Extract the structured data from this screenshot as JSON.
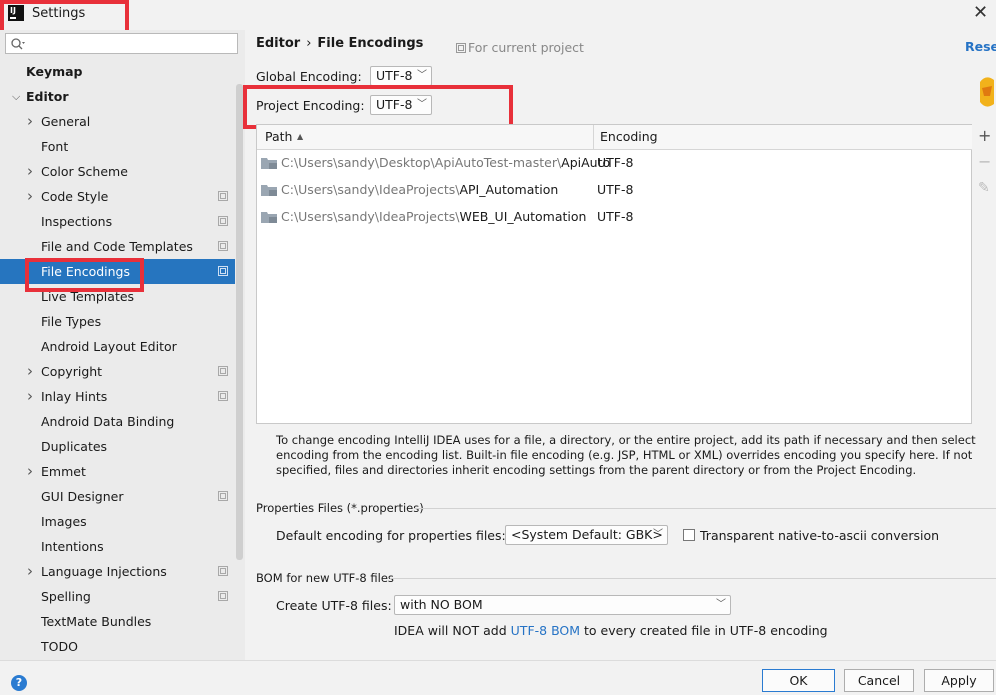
{
  "window": {
    "title": "Settings",
    "app_icon_text": "IJ"
  },
  "search": {
    "placeholder": ""
  },
  "sidebar": {
    "items": [
      {
        "label": "Keymap"
      },
      {
        "label": "Editor"
      },
      {
        "label": "General"
      },
      {
        "label": "Font"
      },
      {
        "label": "Color Scheme"
      },
      {
        "label": "Code Style"
      },
      {
        "label": "Inspections"
      },
      {
        "label": "File and Code Templates"
      },
      {
        "label": "File Encodings"
      },
      {
        "label": "Live Templates"
      },
      {
        "label": "File Types"
      },
      {
        "label": "Android Layout Editor"
      },
      {
        "label": "Copyright"
      },
      {
        "label": "Inlay Hints"
      },
      {
        "label": "Android Data Binding"
      },
      {
        "label": "Duplicates"
      },
      {
        "label": "Emmet"
      },
      {
        "label": "GUI Designer"
      },
      {
        "label": "Images"
      },
      {
        "label": "Intentions"
      },
      {
        "label": "Language Injections"
      },
      {
        "label": "Spelling"
      },
      {
        "label": "TextMate Bundles"
      },
      {
        "label": "TODO"
      }
    ]
  },
  "breadcrumb": {
    "parent": "Editor",
    "separator": "›",
    "current": "File Encodings"
  },
  "for_current_project": "For current project",
  "reset_label": "Reset",
  "global_encoding": {
    "label": "Global Encoding:",
    "value": "UTF-8"
  },
  "project_encoding": {
    "label": "Project Encoding:",
    "value": "UTF-8"
  },
  "table": {
    "headers": {
      "path": "Path",
      "sort": "▲",
      "encoding": "Encoding"
    },
    "rows": [
      {
        "path_prefix": "C:\\Users\\sandy\\Desktop\\ApiAutoTest-master\\",
        "path_name": "ApiAuto",
        "encoding": "UTF-8"
      },
      {
        "path_prefix": "C:\\Users\\sandy\\IdeaProjects\\",
        "path_name": "API_Automation",
        "encoding": "UTF-8"
      },
      {
        "path_prefix": "C:\\Users\\sandy\\IdeaProjects\\",
        "path_name": "WEB_UI_Automation",
        "encoding": "UTF-8"
      }
    ]
  },
  "table_tools": {
    "add": "+",
    "remove": "−",
    "edit": "✎"
  },
  "help_text": "To change encoding IntelliJ IDEA uses for a file, a directory, or the entire project, add its path if necessary and then select encoding from the encoding list. Built-in file encoding (e.g. JSP, HTML or XML) overrides encoding you specify here. If not specified, files and directories inherit encoding settings from the parent directory or from the Project Encoding.",
  "properties": {
    "section_title": "Properties Files (*.properties)",
    "default_label": "Default encoding for properties files:",
    "default_value": "<System Default: GBK>",
    "transparent_label": "Transparent native-to-ascii conversion"
  },
  "bom": {
    "section_title": "BOM for new UTF-8 files",
    "create_label": "Create UTF-8 files:",
    "create_value": "with NO BOM",
    "note_before": "IDEA will NOT add ",
    "note_link": "UTF-8 BOM",
    "note_after": " to every created file in UTF-8 encoding"
  },
  "buttons": {
    "ok": "OK",
    "cancel": "Cancel",
    "apply": "Apply",
    "help": "?"
  },
  "colors": {
    "selection": "#2675bf",
    "highlight": "#e8303a",
    "link": "#2673c5"
  }
}
